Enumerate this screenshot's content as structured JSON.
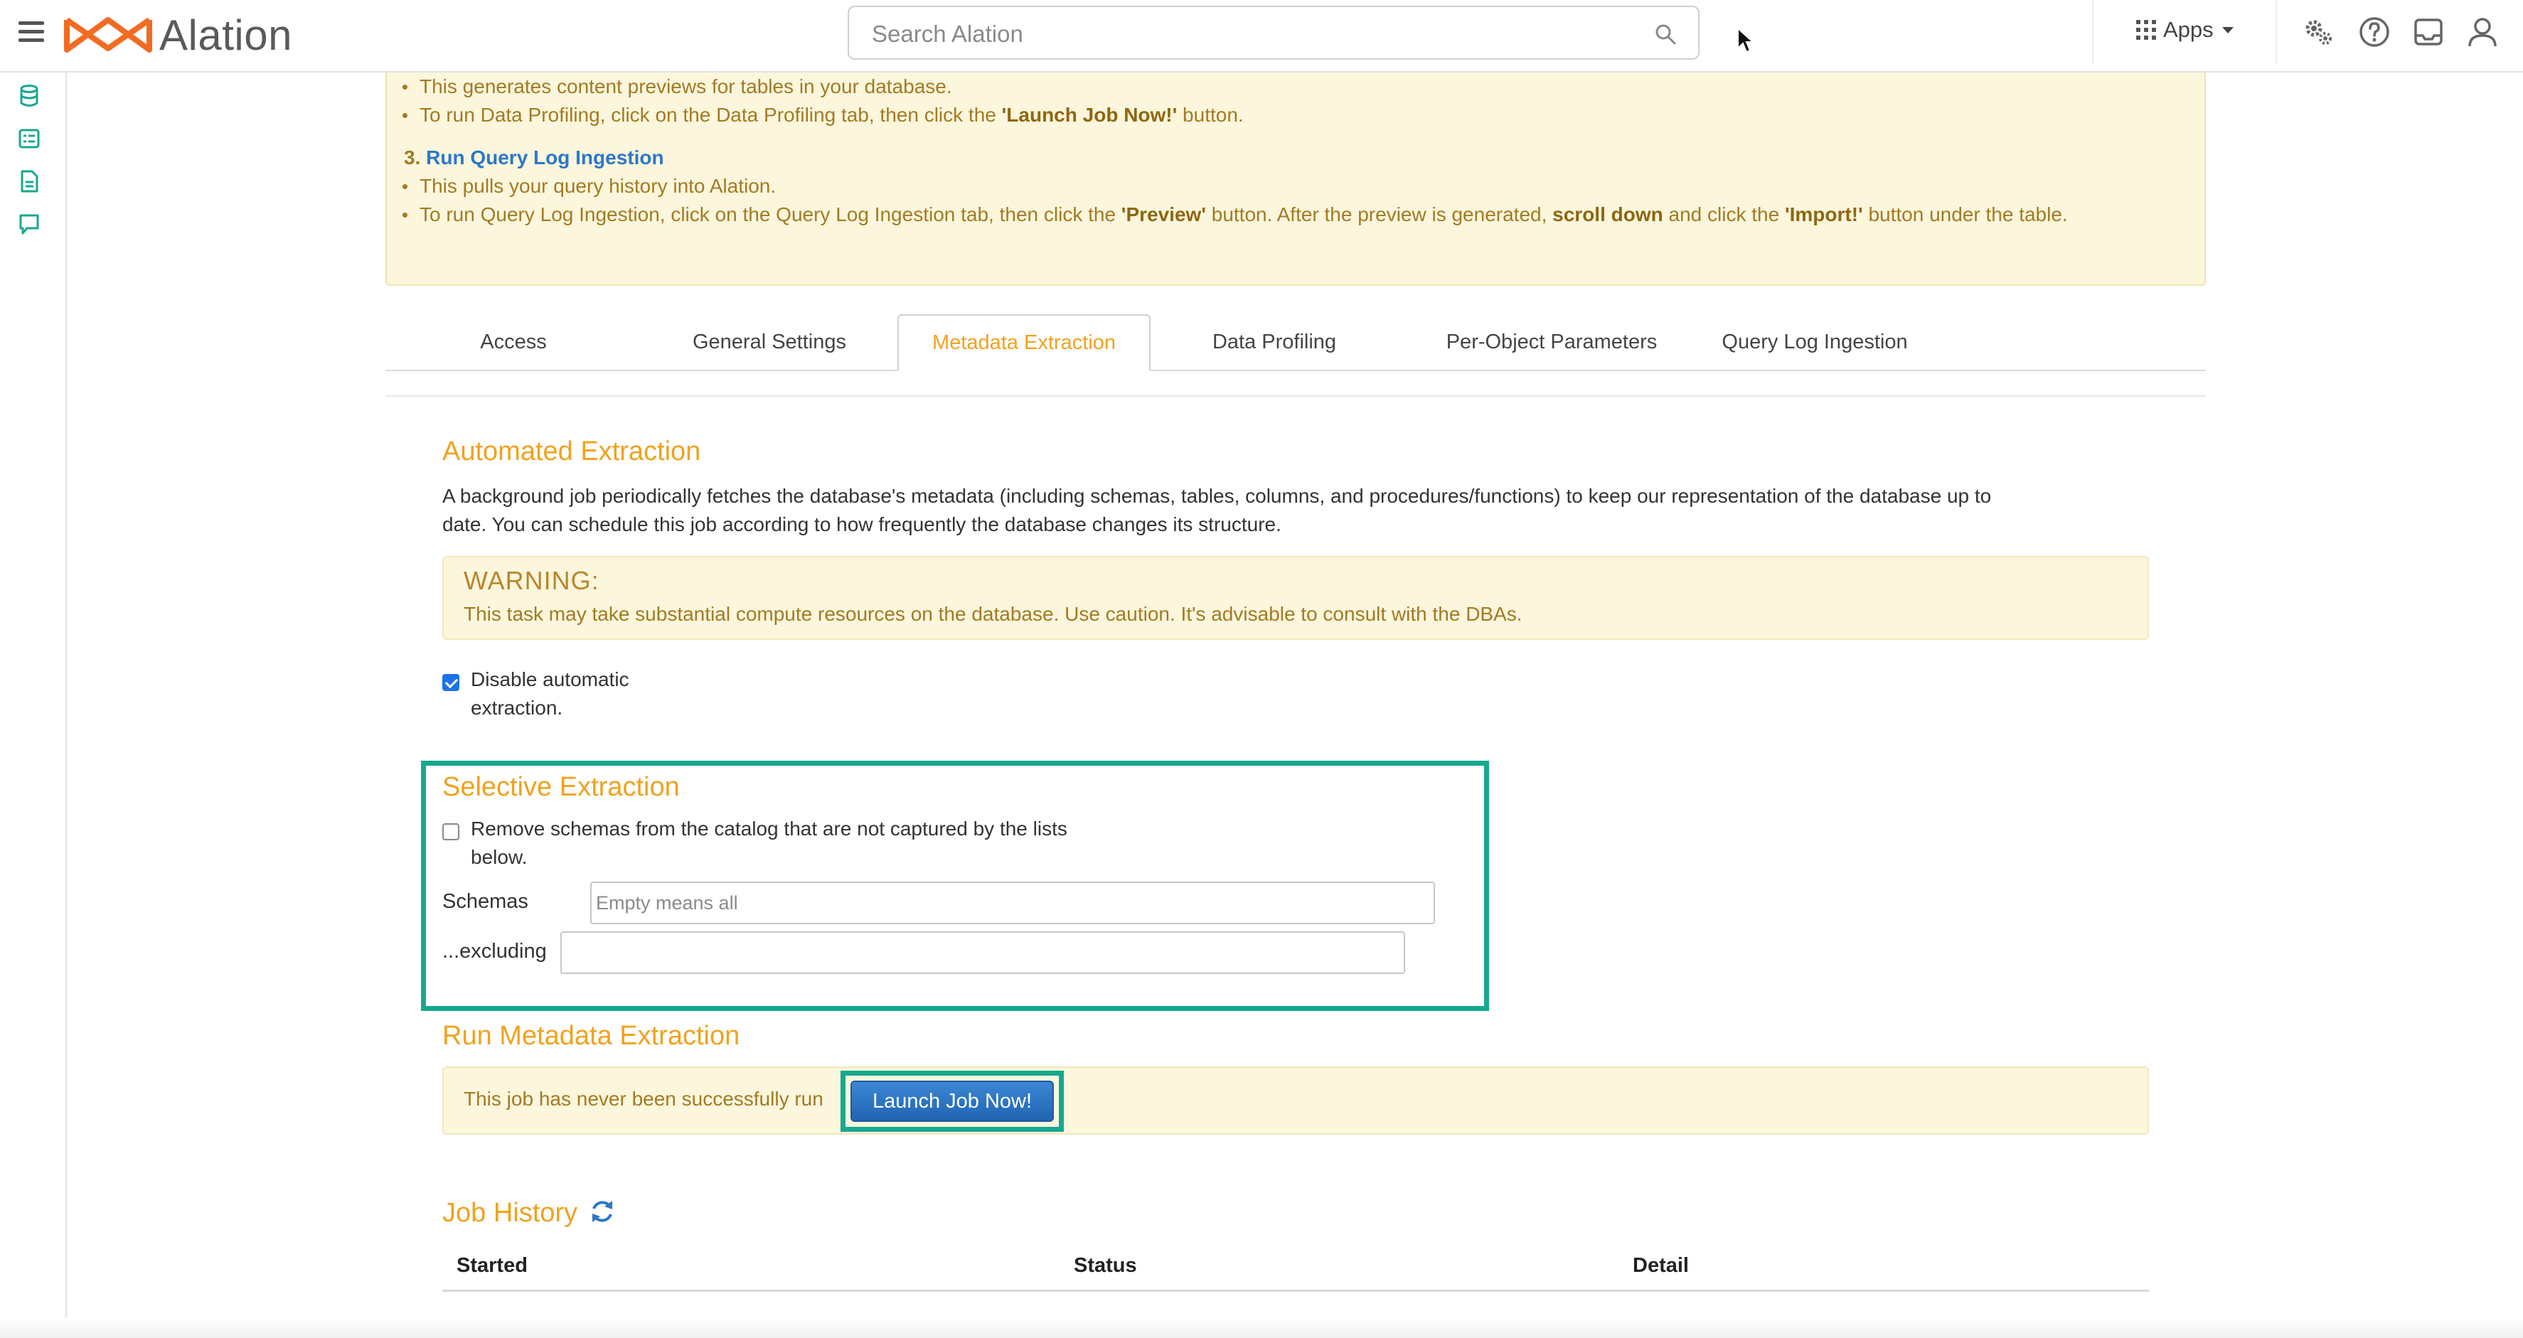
{
  "header": {
    "logo_text": "Alation",
    "search_placeholder": "Search Alation",
    "apps_label": "Apps"
  },
  "notice": {
    "step2_bullets": [
      "This generates content previews for tables in your database.",
      {
        "pre": "To run Data Profiling, click on the Data Profiling tab, then click the ",
        "bold": "'Launch Job Now!'",
        "post": " button."
      }
    ],
    "step3_number": "3.",
    "step3_title": "Run Query Log Ingestion",
    "step3_bullet1": "This pulls your query history into Alation.",
    "step3_bullet2_a": "To run Query Log Ingestion, click on the Query Log Ingestion tab, then click the ",
    "step3_bullet2_b": "'Preview'",
    "step3_bullet2_c": " button. After the preview is generated, ",
    "step3_bullet2_d": "scroll down",
    "step3_bullet2_e": " and click the ",
    "step3_bullet2_f": "'Import!'",
    "step3_bullet2_g": " button under the table."
  },
  "tabs": [
    {
      "label": "Access",
      "active": false
    },
    {
      "label": "General Settings",
      "active": false
    },
    {
      "label": "Metadata Extraction",
      "active": true
    },
    {
      "label": "Data Profiling",
      "active": false
    },
    {
      "label": "Per-Object Parameters",
      "active": false
    },
    {
      "label": "Query Log Ingestion",
      "active": false
    }
  ],
  "automated": {
    "title": "Automated Extraction",
    "description_line1": "A background job periodically fetches the database's metadata (including schemas, tables, columns, and procedures/functions) to keep our representation of the database up to",
    "description_line2": "date. You can schedule this job according to how frequently the database changes its structure.",
    "warning_title": "WARNING:",
    "warning_body": "This task may take substantial compute resources on the database. Use caution. It's advisable to consult with the DBAs.",
    "disable_label_line1": "Disable automatic",
    "disable_label_line2": "extraction.",
    "disable_checked": true
  },
  "selective": {
    "title": "Selective Extraction",
    "remove_label_line1": "Remove schemas from the catalog that are not captured by the lists",
    "remove_label_line2": "below.",
    "remove_checked": false,
    "schemas_label": "Schemas",
    "schemas_placeholder": "Empty means all",
    "excluding_label": "...excluding",
    "excluding_value": ""
  },
  "run": {
    "title": "Run Metadata Extraction",
    "status_text": "This job has never been successfully run",
    "launch_label": "Launch Job Now!"
  },
  "job_history": {
    "title": "Job History",
    "columns": [
      "Started",
      "Status",
      "Detail"
    ]
  },
  "colors": {
    "accent_orange": "#f0a21e",
    "highlight_teal": "#17a88f",
    "link_blue": "#2d77c9",
    "notice_bg": "#fbf6dc"
  }
}
